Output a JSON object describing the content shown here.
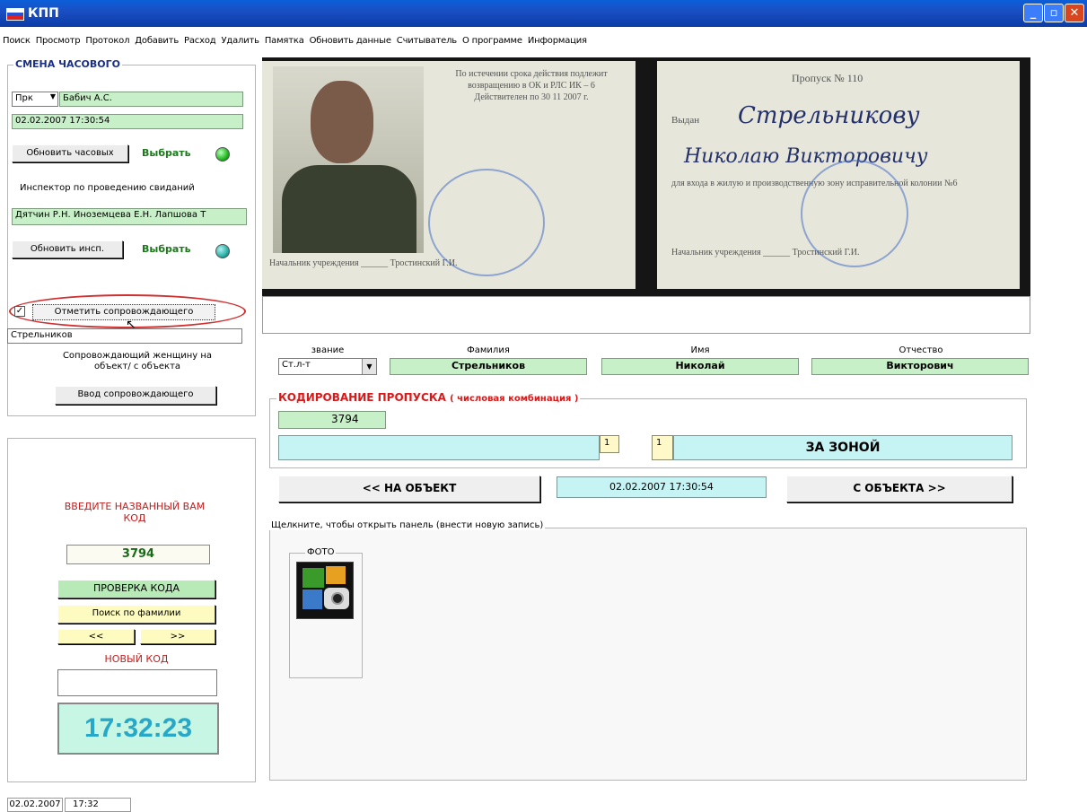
{
  "window": {
    "title": "КПП"
  },
  "menu": [
    "Поиск",
    "Просмотр",
    "Протокол",
    "Добавить",
    "Расход",
    "Удалить",
    "Памятка",
    "Обновить данные",
    "Считыватель",
    "О программе",
    "Информация"
  ],
  "guard_shift": {
    "legend": "СМЕНА ЧАСОВОГО",
    "rank_select": "Прк",
    "guard_name": "Бабич А.С.",
    "datetime": "02.02.2007 17:30:54",
    "refresh_guards_label": "Обновить часовых",
    "select_label": "Выбрать",
    "inspector_label": "Инспектор по проведению свиданий",
    "inspectors": "Дятчин Р.Н. Иноземцева Е.Н. Лапшова Т",
    "refresh_insp_label": "Обновить инсп.",
    "select_label_2": "Выбрать",
    "escort_checkbox_label": "Отметить сопровождающего",
    "escort_name": "Стрельников",
    "escort_note": "Сопровождающий женщину на объект/ с объекта",
    "escort_button": "Ввод сопровождающего"
  },
  "code_panel": {
    "prompt": "ВВЕДИТЕ НАЗВАННЫЙ ВАМ КОД",
    "code_value": "3794",
    "check_button": "ПРОВЕРКА КОДА",
    "search_surname_button": "Поиск по фамилии",
    "prev_button": "<<",
    "next_button": ">>",
    "new_code_label": "НОВЫЙ КОД",
    "new_code_value": "",
    "clock": "17:32:23"
  },
  "pass_card": {
    "left_text": "По истечении срока действия подлежит возвращению в ОК и РЛС ИК – 6 Действителен по 30 11 2007 г.",
    "left_footer": "Начальник учреждения ______ Тростинский Г.И.",
    "pass_no": "Пропуск № 110",
    "issued_label": "Выдан",
    "issued_surname": "Стрельникову",
    "issued_names": "Николаю Викторовичу",
    "purpose": "для входа в жилую и производственную зону исправительной колонии №6",
    "right_footer": "Начальник учреждения ______ Тростинский Г.И."
  },
  "person": {
    "headers": {
      "rank": "звание",
      "surname": "Фамилия",
      "name": "Имя",
      "patronymic": "Отчество"
    },
    "rank": "Ст.л-т",
    "surname": "Стрельников",
    "name": "Николай",
    "patronymic": "Викторович"
  },
  "coding": {
    "title": "КОДИРОВАНИЕ ПРОПУСКА",
    "subtitle": "( числовая комбинация )",
    "code": "3794",
    "field_main": "",
    "num1": "1",
    "num2": "1",
    "zone": "ЗА ЗОНОЙ",
    "to_object": "<< НА ОБЪЕКТ",
    "datetime": "02.02.2007 17:30:54",
    "from_object": "С ОБЪЕКТА >>"
  },
  "records": {
    "hint": "Щелкните, чтобы открыть панель (внести новую запись)",
    "photo_label": "ФОТО"
  },
  "statusbar": {
    "date": "02.02.2007",
    "time": "17:32"
  },
  "colors": {
    "titlebar": "#0a5fd8",
    "green_field": "#c8f0c8",
    "cyan_field": "#c6f4f4",
    "red_accent": "#d81a1a",
    "clock": "#27a8c8"
  }
}
